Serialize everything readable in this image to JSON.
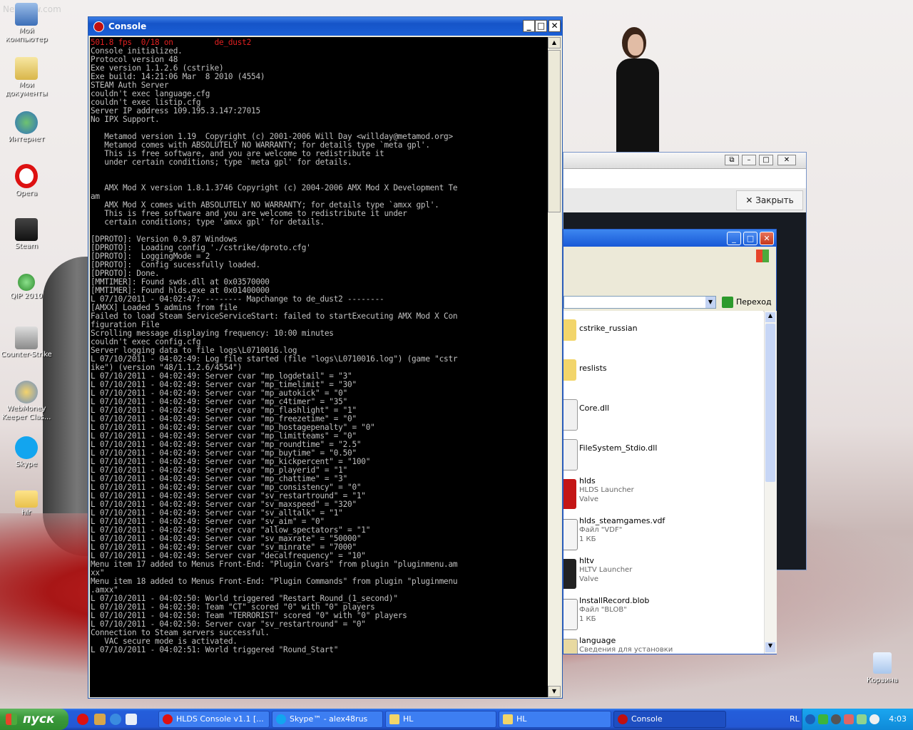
{
  "desktop": {
    "watermark": "NetShow.com",
    "icons": [
      {
        "label": "Мой компьютер"
      },
      {
        "label": "Мои документы"
      },
      {
        "label": "Интернет"
      },
      {
        "label": "Opera"
      },
      {
        "label": "Steam"
      },
      {
        "label": "QIP 2010"
      },
      {
        "label": "Counter-Strike"
      },
      {
        "label": "WebMoney Keeper Clas..."
      },
      {
        "label": "Skype"
      },
      {
        "label": "hlr"
      }
    ],
    "recycle_bin": "Корзина"
  },
  "console": {
    "title": "Console",
    "fps_line": "501.8 fps  0/18 on         de_dust2",
    "lines": [
      "Console initialized.",
      "Protocol version 48",
      "Exe version 1.1.2.6 (cstrike)",
      "Exe build: 14:21:06 Mar  8 2010 (4554)",
      "STEAM Auth Server",
      "couldn't exec language.cfg",
      "couldn't exec listip.cfg",
      "Server IP address 109.195.3.147:27015",
      "No IPX Support.",
      "",
      "   Metamod version 1.19  Copyright (c) 2001-2006 Will Day <willday@metamod.org>",
      "   Metamod comes with ABSOLUTELY NO WARRANTY; for details type `meta gpl'.",
      "   This is free software, and you are welcome to redistribute it",
      "   under certain conditions; type `meta gpl' for details.",
      "",
      "",
      "   AMX Mod X version 1.8.1.3746 Copyright (c) 2004-2006 AMX Mod X Development Te",
      "am",
      "   AMX Mod X comes with ABSOLUTELY NO WARRANTY; for details type `amxx gpl'.",
      "   This is free software and you are welcome to redistribute it under",
      "   certain conditions; type 'amxx gpl' for details.",
      "",
      "[DPROTO]: Version 0.9.87 Windows",
      "[DPROTO]:  Loading config './cstrike/dproto.cfg'",
      "[DPROTO]:  LoggingMode = 2",
      "[DPROTO]:  Config sucessfully loaded.",
      "[DPROTO]: Done.",
      "[MMTIMER]: Found swds.dll at 0x03570000",
      "[MMTIMER]: Found hlds.exe at 0x01400000",
      "L 07/10/2011 - 04:02:47: -------- Mapchange to de_dust2 --------",
      "[AMXX] Loaded 5 admins from file",
      "Failed to load Steam ServiceServiceStart: failed to startExecuting AMX Mod X Con",
      "figuration File",
      "Scrolling message displaying frequency: 10:00 minutes",
      "couldn't exec config.cfg",
      "Server logging data to file logs\\L0710016.log",
      "L 07/10/2011 - 04:02:49: Log file started (file \"logs\\L0710016.log\") (game \"cstr",
      "ike\") (version \"48/1.1.2.6/4554\")",
      "L 07/10/2011 - 04:02:49: Server cvar \"mp_logdetail\" = \"3\"",
      "L 07/10/2011 - 04:02:49: Server cvar \"mp_timelimit\" = \"30\"",
      "L 07/10/2011 - 04:02:49: Server cvar \"mp_autokick\" = \"0\"",
      "L 07/10/2011 - 04:02:49: Server cvar \"mp_c4timer\" = \"35\"",
      "L 07/10/2011 - 04:02:49: Server cvar \"mp_flashlight\" = \"1\"",
      "L 07/10/2011 - 04:02:49: Server cvar \"mp_freezetime\" = \"0\"",
      "L 07/10/2011 - 04:02:49: Server cvar \"mp_hostagepenalty\" = \"0\"",
      "L 07/10/2011 - 04:02:49: Server cvar \"mp_limitteams\" = \"0\"",
      "L 07/10/2011 - 04:02:49: Server cvar \"mp_roundtime\" = \"2.5\"",
      "L 07/10/2011 - 04:02:49: Server cvar \"mp_buytime\" = \"0.50\"",
      "L 07/10/2011 - 04:02:49: Server cvar \"mp_kickpercent\" = \"100\"",
      "L 07/10/2011 - 04:02:49: Server cvar \"mp_playerid\" = \"1\"",
      "L 07/10/2011 - 04:02:49: Server cvar \"mp_chattime\" = \"3\"",
      "L 07/10/2011 - 04:02:49: Server cvar \"mp_consistency\" = \"0\"",
      "L 07/10/2011 - 04:02:49: Server cvar \"sv_restartround\" = \"1\"",
      "L 07/10/2011 - 04:02:49: Server cvar \"sv_maxspeed\" = \"320\"",
      "L 07/10/2011 - 04:02:49: Server cvar \"sv_alltalk\" = \"1\"",
      "L 07/10/2011 - 04:02:49: Server cvar \"sv_aim\" = \"0\"",
      "L 07/10/2011 - 04:02:49: Server cvar \"allow_spectators\" = \"1\"",
      "L 07/10/2011 - 04:02:49: Server cvar \"sv_maxrate\" = \"50000\"",
      "L 07/10/2011 - 04:02:49: Server cvar \"sv_minrate\" = \"7000\"",
      "L 07/10/2011 - 04:02:49: Server cvar \"decalfrequency\" = \"10\"",
      "Menu item 17 added to Menus Front-End: \"Plugin Cvars\" from plugin \"pluginmenu.am",
      "xx\"",
      "Menu item 18 added to Menus Front-End: \"Plugin Commands\" from plugin \"pluginmenu",
      ".amxx\"",
      "L 07/10/2011 - 04:02:50: World triggered \"Restart_Round_(1_second)\"",
      "L 07/10/2011 - 04:02:50: Team \"CT\" scored \"0\" with \"0\" players",
      "L 07/10/2011 - 04:02:50: Team \"TERRORIST\" scored \"0\" with \"0\" players",
      "L 07/10/2011 - 04:02:50: Server cvar \"sv_restartround\" = \"0\"",
      "Connection to Steam servers successful.",
      "   VAC secure mode is activated.",
      "L 07/10/2011 - 04:02:51: World triggered \"Round_Start\""
    ]
  },
  "back_window": {
    "close_label": "Закрыть"
  },
  "explorer": {
    "go_label": "Переход",
    "files": [
      {
        "name": "cstrike_russian",
        "sub": []
      },
      {
        "name": "reslists",
        "sub": []
      },
      {
        "name": "Core.dll",
        "sub": []
      },
      {
        "name": "FileSystem_Stdio.dll",
        "sub": []
      },
      {
        "name": "hlds",
        "sub": [
          "HLDS Launcher",
          "Valve"
        ]
      },
      {
        "name": "hlds_steamgames.vdf",
        "sub": [
          "Файл \"VDF\"",
          "1 КБ"
        ]
      },
      {
        "name": "hltv",
        "sub": [
          "HLTV Launcher",
          "Valve"
        ]
      },
      {
        "name": "InstallRecord.blob",
        "sub": [
          "Файл \"BLOB\"",
          "1 КБ"
        ]
      },
      {
        "name": "language",
        "sub": [
          "Сведения для установки"
        ]
      }
    ]
  },
  "taskbar": {
    "start_label": "пуск",
    "tasks": [
      {
        "label": "HLDS Console v1.1 [..."
      },
      {
        "label": "Skype™ - alex48rus"
      },
      {
        "label": "HL"
      },
      {
        "label": "HL"
      },
      {
        "label": "Console"
      }
    ],
    "lang": "RL",
    "clock": "4:03"
  },
  "colors": {
    "xp_blue": "#0248c6",
    "console_bg": "#000000",
    "console_text": "#c0c0c0",
    "fps_red": "#e02020",
    "start_green": "#3c9a3c"
  }
}
